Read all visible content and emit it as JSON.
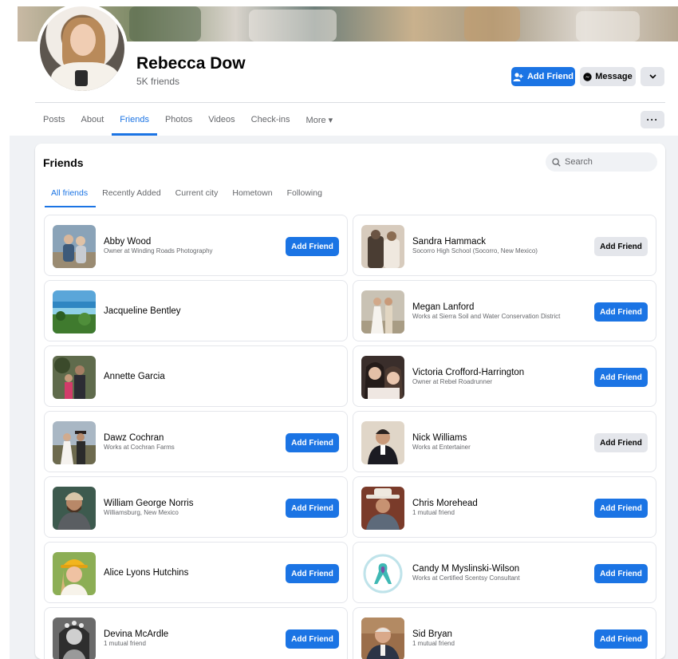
{
  "profile": {
    "name": "Rebecca Dow",
    "friends_count": "5K friends",
    "add_friend_label": "Add Friend",
    "message_label": "Message",
    "more_icon": "chevron-down-icon"
  },
  "profile_tabs": [
    {
      "label": "Posts"
    },
    {
      "label": "About"
    },
    {
      "label": "Friends",
      "active": true
    },
    {
      "label": "Photos"
    },
    {
      "label": "Videos"
    },
    {
      "label": "Check-ins"
    },
    {
      "label": "More ▾"
    }
  ],
  "tabs_more_label": "···",
  "friends_section": {
    "title": "Friends",
    "search_placeholder": "Search",
    "sub_tabs": [
      {
        "label": "All friends",
        "active": true
      },
      {
        "label": "Recently Added"
      },
      {
        "label": "Current city"
      },
      {
        "label": "Hometown"
      },
      {
        "label": "Following"
      }
    ]
  },
  "friends": [
    {
      "name": "Abby Wood",
      "subtitle": "Owner at Winding Roads Photography",
      "button": "Add Friend",
      "button_style": "primary"
    },
    {
      "name": "Sandra Hammack",
      "subtitle": "Socorro High School (Socorro, New Mexico)",
      "button": "Add Friend",
      "button_style": "secondary"
    },
    {
      "name": "Jacqueline Bentley",
      "subtitle": "",
      "button": "",
      "button_style": "none"
    },
    {
      "name": "Megan Lanford",
      "subtitle": "Works at Sierra Soil and Water Conservation District",
      "button": "Add Friend",
      "button_style": "primary"
    },
    {
      "name": "Annette Garcia",
      "subtitle": "",
      "button": "",
      "button_style": "none"
    },
    {
      "name": "Victoria Crofford-Harrington",
      "subtitle": "Owner at Rebel Roadrunner",
      "button": "Add Friend",
      "button_style": "primary"
    },
    {
      "name": "Dawz Cochran",
      "subtitle": "Works at Cochran Farms",
      "button": "Add Friend",
      "button_style": "primary"
    },
    {
      "name": "Nick Williams",
      "subtitle": "Works at Entertainer",
      "button": "Add Friend",
      "button_style": "secondary"
    },
    {
      "name": "William George Norris",
      "subtitle": "Williamsburg, New Mexico",
      "button": "Add Friend",
      "button_style": "primary"
    },
    {
      "name": "Chris Morehead",
      "subtitle": "1 mutual friend",
      "button": "Add Friend",
      "button_style": "primary"
    },
    {
      "name": "Alice Lyons Hutchins",
      "subtitle": "",
      "button": "Add Friend",
      "button_style": "primary"
    },
    {
      "name": "Candy M Myslinski-Wilson",
      "subtitle": "Works at Certified Scentsy Consultant",
      "button": "Add Friend",
      "button_style": "primary"
    },
    {
      "name": "Devina McArdle",
      "subtitle": "1 mutual friend",
      "button": "Add Friend",
      "button_style": "primary"
    },
    {
      "name": "Sid Bryan",
      "subtitle": "1 mutual friend",
      "button": "Add Friend",
      "button_style": "primary"
    }
  ],
  "colors": {
    "accent": "#1b74e4",
    "secondary_button": "#e4e6eb",
    "page_bg": "#f0f2f5",
    "muted_text": "#65676b"
  }
}
